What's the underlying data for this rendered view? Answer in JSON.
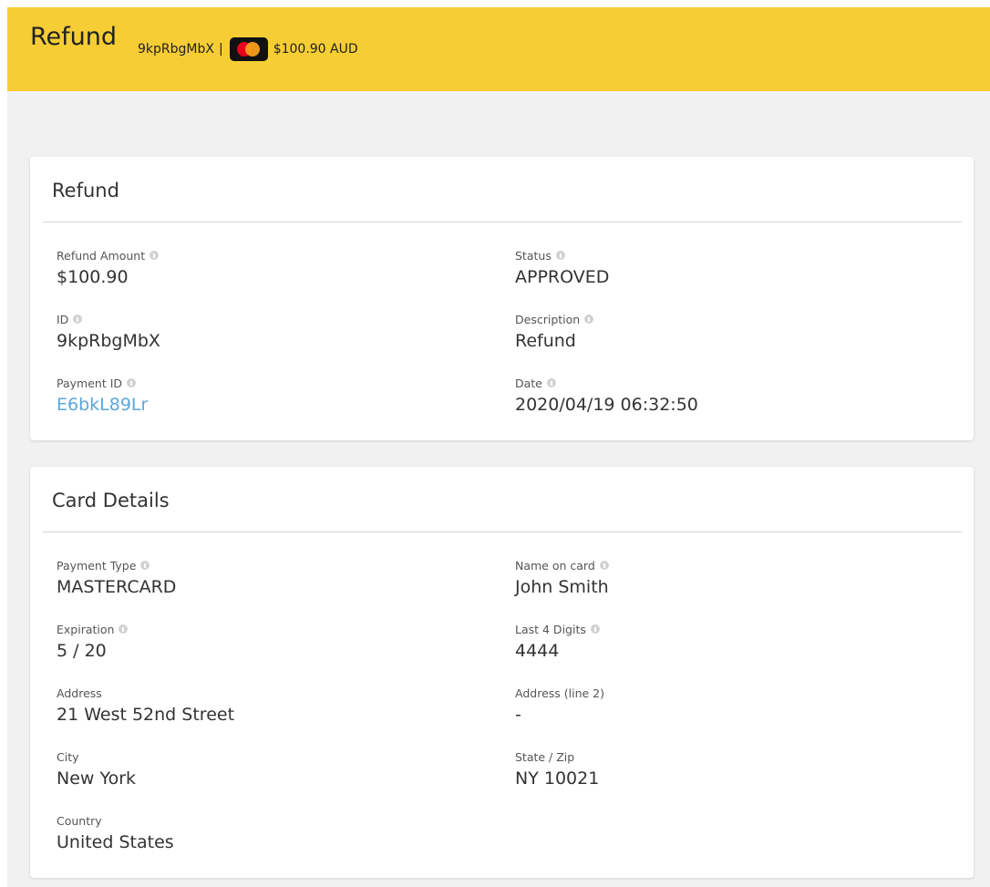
{
  "header": {
    "title": "Refund",
    "refund_id": "9kpRbgMbX",
    "separator": "|",
    "card_icon": "mastercard-icon",
    "amount": "$100.90 AUD",
    "bg_color": "#f6cd34"
  },
  "refund_panel": {
    "title": "Refund",
    "fields": [
      {
        "label": "Refund Amount",
        "value": "$100.90",
        "info": true
      },
      {
        "label": "Status",
        "value": "APPROVED",
        "info": true
      },
      {
        "label": "ID",
        "value": "9kpRbgMbX",
        "info": true
      },
      {
        "label": "Description",
        "value": "Refund",
        "info": true
      },
      {
        "label": "Payment ID",
        "value": "E6bkL89Lr",
        "info": true,
        "link": true
      },
      {
        "label": "Date",
        "value": "2020/04/19 06:32:50",
        "info": true
      }
    ]
  },
  "card_panel": {
    "title": "Card Details",
    "fields": [
      {
        "label": "Payment Type",
        "value": "MASTERCARD",
        "info": true
      },
      {
        "label": "Name on card",
        "value": "John Smith",
        "info": true
      },
      {
        "label": "Expiration",
        "value": "5 / 20",
        "info": true
      },
      {
        "label": "Last 4 Digits",
        "value": "4444",
        "info": true
      },
      {
        "label": "Address",
        "value": "21 West 52nd Street",
        "info": false
      },
      {
        "label": "Address (line 2)",
        "value": "-",
        "info": false
      },
      {
        "label": "City",
        "value": "New York",
        "info": false
      },
      {
        "label": "State / Zip",
        "value": "NY 10021",
        "info": false
      },
      {
        "label": "Country",
        "value": "United States",
        "info": false
      }
    ]
  },
  "colors": {
    "link": "#5da7db",
    "page_bg": "#f1f1f1",
    "info_icon": "#d2d2d2"
  }
}
